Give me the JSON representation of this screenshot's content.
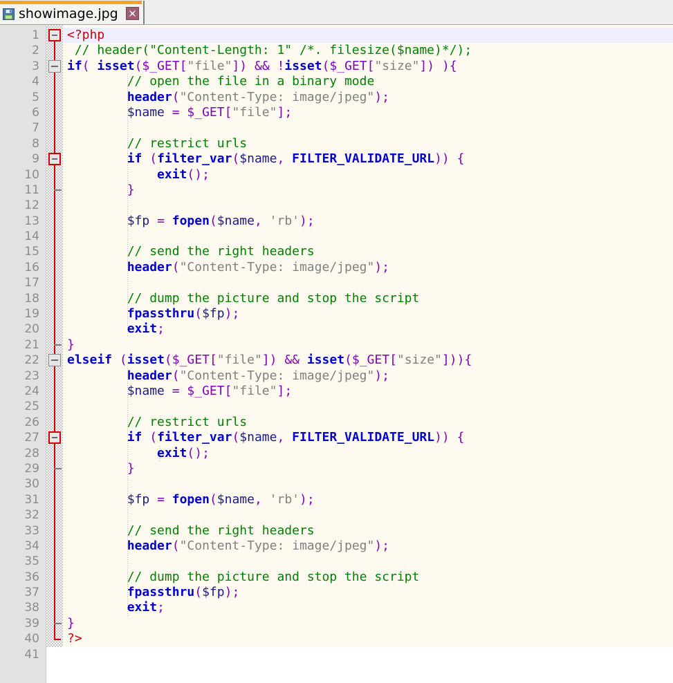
{
  "window": {
    "title": "showimage.jpg"
  },
  "tab": {
    "label": "showimage.jpg",
    "icon": "save-floppy-icon",
    "close_label": "×",
    "active_accent_color": "#f5a02b",
    "close_button_color": "#9d5f72"
  },
  "editor": {
    "language": "php",
    "first_line": 1,
    "last_line": 41,
    "current_line": 1,
    "background_color": "#fffaf0",
    "gutter_color": "#e2e2e2",
    "current_line_color": "#eeeeff",
    "fold_marker_color": "#d40000",
    "line_numbers": [
      "1",
      "2",
      "3",
      "4",
      "5",
      "6",
      "7",
      "8",
      "9",
      "10",
      "11",
      "12",
      "13",
      "14",
      "15",
      "16",
      "17",
      "18",
      "19",
      "20",
      "21",
      "22",
      "23",
      "24",
      "25",
      "26",
      "27",
      "28",
      "29",
      "30",
      "31",
      "32",
      "33",
      "34",
      "35",
      "36",
      "37",
      "38",
      "39",
      "40",
      "41"
    ],
    "lines": [
      {
        "n": 1,
        "tokens": [
          {
            "t": "<?php",
            "c": "t-php"
          }
        ]
      },
      {
        "n": 2,
        "tokens": [
          {
            "t": " ",
            "c": "t-plain"
          },
          {
            "t": "// header(\"Content-Length: 1\" /*. filesize($name)*/);",
            "c": "t-cmt"
          }
        ]
      },
      {
        "n": 3,
        "tokens": [
          {
            "t": "if",
            "c": "t-kw"
          },
          {
            "t": "(",
            "c": "t-op"
          },
          {
            "t": " ",
            "c": "t-plain"
          },
          {
            "t": "isset",
            "c": "t-fn"
          },
          {
            "t": "(",
            "c": "t-op"
          },
          {
            "t": "$_GET",
            "c": "t-op"
          },
          {
            "t": "[",
            "c": "t-op"
          },
          {
            "t": "\"file\"",
            "c": "t-str"
          },
          {
            "t": "])",
            "c": "t-op"
          },
          {
            "t": " ",
            "c": "t-plain"
          },
          {
            "t": "&&",
            "c": "t-op"
          },
          {
            "t": " ",
            "c": "t-plain"
          },
          {
            "t": "!",
            "c": "t-op"
          },
          {
            "t": "isset",
            "c": "t-fn"
          },
          {
            "t": "(",
            "c": "t-op"
          },
          {
            "t": "$_GET",
            "c": "t-op"
          },
          {
            "t": "[",
            "c": "t-op"
          },
          {
            "t": "\"size\"",
            "c": "t-str"
          },
          {
            "t": "])",
            "c": "t-op"
          },
          {
            "t": " ",
            "c": "t-plain"
          },
          {
            "t": "){",
            "c": "t-op"
          }
        ]
      },
      {
        "n": 4,
        "tokens": [
          {
            "t": "        ",
            "c": "t-plain"
          },
          {
            "t": "// open the file in a binary mode",
            "c": "t-cmt"
          }
        ]
      },
      {
        "n": 5,
        "tokens": [
          {
            "t": "        ",
            "c": "t-plain"
          },
          {
            "t": "header",
            "c": "t-fn"
          },
          {
            "t": "(",
            "c": "t-op"
          },
          {
            "t": "\"Content-Type: image/jpeg\"",
            "c": "t-str"
          },
          {
            "t": ");",
            "c": "t-op"
          }
        ]
      },
      {
        "n": 6,
        "tokens": [
          {
            "t": "        ",
            "c": "t-plain"
          },
          {
            "t": "$name",
            "c": "t-var"
          },
          {
            "t": " ",
            "c": "t-plain"
          },
          {
            "t": "=",
            "c": "t-op"
          },
          {
            "t": " ",
            "c": "t-plain"
          },
          {
            "t": "$_GET",
            "c": "t-op"
          },
          {
            "t": "[",
            "c": "t-op"
          },
          {
            "t": "\"file\"",
            "c": "t-str"
          },
          {
            "t": "];",
            "c": "t-op"
          }
        ]
      },
      {
        "n": 7,
        "tokens": []
      },
      {
        "n": 8,
        "tokens": [
          {
            "t": "        ",
            "c": "t-plain"
          },
          {
            "t": "// restrict urls",
            "c": "t-cmt"
          }
        ]
      },
      {
        "n": 9,
        "tokens": [
          {
            "t": "        ",
            "c": "t-plain"
          },
          {
            "t": "if",
            "c": "t-kw"
          },
          {
            "t": " ",
            "c": "t-plain"
          },
          {
            "t": "(",
            "c": "t-op"
          },
          {
            "t": "filter_var",
            "c": "t-fn"
          },
          {
            "t": "(",
            "c": "t-op"
          },
          {
            "t": "$name",
            "c": "t-var"
          },
          {
            "t": ",",
            "c": "t-op"
          },
          {
            "t": " ",
            "c": "t-plain"
          },
          {
            "t": "FILTER_VALIDATE_URL",
            "c": "t-const"
          },
          {
            "t": "))",
            "c": "t-op"
          },
          {
            "t": " ",
            "c": "t-plain"
          },
          {
            "t": "{",
            "c": "t-op"
          }
        ]
      },
      {
        "n": 10,
        "tokens": [
          {
            "t": "            ",
            "c": "t-plain"
          },
          {
            "t": "exit",
            "c": "t-kw"
          },
          {
            "t": "();",
            "c": "t-op"
          }
        ]
      },
      {
        "n": 11,
        "tokens": [
          {
            "t": "        ",
            "c": "t-plain"
          },
          {
            "t": "}",
            "c": "t-op"
          }
        ]
      },
      {
        "n": 12,
        "tokens": []
      },
      {
        "n": 13,
        "tokens": [
          {
            "t": "        ",
            "c": "t-plain"
          },
          {
            "t": "$fp",
            "c": "t-var"
          },
          {
            "t": " ",
            "c": "t-plain"
          },
          {
            "t": "=",
            "c": "t-op"
          },
          {
            "t": " ",
            "c": "t-plain"
          },
          {
            "t": "fopen",
            "c": "t-fn"
          },
          {
            "t": "(",
            "c": "t-op"
          },
          {
            "t": "$name",
            "c": "t-var"
          },
          {
            "t": ",",
            "c": "t-op"
          },
          {
            "t": " ",
            "c": "t-plain"
          },
          {
            "t": "'rb'",
            "c": "t-str"
          },
          {
            "t": ");",
            "c": "t-op"
          }
        ]
      },
      {
        "n": 14,
        "tokens": []
      },
      {
        "n": 15,
        "tokens": [
          {
            "t": "        ",
            "c": "t-plain"
          },
          {
            "t": "// send the right headers",
            "c": "t-cmt"
          }
        ]
      },
      {
        "n": 16,
        "tokens": [
          {
            "t": "        ",
            "c": "t-plain"
          },
          {
            "t": "header",
            "c": "t-fn"
          },
          {
            "t": "(",
            "c": "t-op"
          },
          {
            "t": "\"Content-Type: image/jpeg\"",
            "c": "t-str"
          },
          {
            "t": ");",
            "c": "t-op"
          }
        ]
      },
      {
        "n": 17,
        "tokens": []
      },
      {
        "n": 18,
        "tokens": [
          {
            "t": "        ",
            "c": "t-plain"
          },
          {
            "t": "// dump the picture and stop the script",
            "c": "t-cmt"
          }
        ]
      },
      {
        "n": 19,
        "tokens": [
          {
            "t": "        ",
            "c": "t-plain"
          },
          {
            "t": "fpassthru",
            "c": "t-fn"
          },
          {
            "t": "(",
            "c": "t-op"
          },
          {
            "t": "$fp",
            "c": "t-var"
          },
          {
            "t": ");",
            "c": "t-op"
          }
        ]
      },
      {
        "n": 20,
        "tokens": [
          {
            "t": "        ",
            "c": "t-plain"
          },
          {
            "t": "exit",
            "c": "t-kw"
          },
          {
            "t": ";",
            "c": "t-op"
          }
        ]
      },
      {
        "n": 21,
        "tokens": [
          {
            "t": "}",
            "c": "t-op"
          }
        ]
      },
      {
        "n": 22,
        "tokens": [
          {
            "t": "elseif",
            "c": "t-kw"
          },
          {
            "t": " ",
            "c": "t-plain"
          },
          {
            "t": "(",
            "c": "t-op"
          },
          {
            "t": "isset",
            "c": "t-fn"
          },
          {
            "t": "(",
            "c": "t-op"
          },
          {
            "t": "$_GET",
            "c": "t-op"
          },
          {
            "t": "[",
            "c": "t-op"
          },
          {
            "t": "\"file\"",
            "c": "t-str"
          },
          {
            "t": "])",
            "c": "t-op"
          },
          {
            "t": " ",
            "c": "t-plain"
          },
          {
            "t": "&&",
            "c": "t-op"
          },
          {
            "t": " ",
            "c": "t-plain"
          },
          {
            "t": "isset",
            "c": "t-fn"
          },
          {
            "t": "(",
            "c": "t-op"
          },
          {
            "t": "$_GET",
            "c": "t-op"
          },
          {
            "t": "[",
            "c": "t-op"
          },
          {
            "t": "\"size\"",
            "c": "t-str"
          },
          {
            "t": "])){",
            "c": "t-op"
          }
        ]
      },
      {
        "n": 23,
        "tokens": [
          {
            "t": "        ",
            "c": "t-plain"
          },
          {
            "t": "header",
            "c": "t-fn"
          },
          {
            "t": "(",
            "c": "t-op"
          },
          {
            "t": "\"Content-Type: image/jpeg\"",
            "c": "t-str"
          },
          {
            "t": ");",
            "c": "t-op"
          }
        ]
      },
      {
        "n": 24,
        "tokens": [
          {
            "t": "        ",
            "c": "t-plain"
          },
          {
            "t": "$name",
            "c": "t-var"
          },
          {
            "t": " ",
            "c": "t-plain"
          },
          {
            "t": "=",
            "c": "t-op"
          },
          {
            "t": " ",
            "c": "t-plain"
          },
          {
            "t": "$_GET",
            "c": "t-op"
          },
          {
            "t": "[",
            "c": "t-op"
          },
          {
            "t": "\"file\"",
            "c": "t-str"
          },
          {
            "t": "];",
            "c": "t-op"
          }
        ]
      },
      {
        "n": 25,
        "tokens": []
      },
      {
        "n": 26,
        "tokens": [
          {
            "t": "        ",
            "c": "t-plain"
          },
          {
            "t": "// restrict urls",
            "c": "t-cmt"
          }
        ]
      },
      {
        "n": 27,
        "tokens": [
          {
            "t": "        ",
            "c": "t-plain"
          },
          {
            "t": "if",
            "c": "t-kw"
          },
          {
            "t": " ",
            "c": "t-plain"
          },
          {
            "t": "(",
            "c": "t-op"
          },
          {
            "t": "filter_var",
            "c": "t-fn"
          },
          {
            "t": "(",
            "c": "t-op"
          },
          {
            "t": "$name",
            "c": "t-var"
          },
          {
            "t": ",",
            "c": "t-op"
          },
          {
            "t": " ",
            "c": "t-plain"
          },
          {
            "t": "FILTER_VALIDATE_URL",
            "c": "t-const"
          },
          {
            "t": "))",
            "c": "t-op"
          },
          {
            "t": " ",
            "c": "t-plain"
          },
          {
            "t": "{",
            "c": "t-op"
          }
        ]
      },
      {
        "n": 28,
        "tokens": [
          {
            "t": "            ",
            "c": "t-plain"
          },
          {
            "t": "exit",
            "c": "t-kw"
          },
          {
            "t": "();",
            "c": "t-op"
          }
        ]
      },
      {
        "n": 29,
        "tokens": [
          {
            "t": "        ",
            "c": "t-plain"
          },
          {
            "t": "}",
            "c": "t-op"
          }
        ]
      },
      {
        "n": 30,
        "tokens": []
      },
      {
        "n": 31,
        "tokens": [
          {
            "t": "        ",
            "c": "t-plain"
          },
          {
            "t": "$fp",
            "c": "t-var"
          },
          {
            "t": " ",
            "c": "t-plain"
          },
          {
            "t": "=",
            "c": "t-op"
          },
          {
            "t": " ",
            "c": "t-plain"
          },
          {
            "t": "fopen",
            "c": "t-fn"
          },
          {
            "t": "(",
            "c": "t-op"
          },
          {
            "t": "$name",
            "c": "t-var"
          },
          {
            "t": ",",
            "c": "t-op"
          },
          {
            "t": " ",
            "c": "t-plain"
          },
          {
            "t": "'rb'",
            "c": "t-str"
          },
          {
            "t": ");",
            "c": "t-op"
          }
        ]
      },
      {
        "n": 32,
        "tokens": []
      },
      {
        "n": 33,
        "tokens": [
          {
            "t": "        ",
            "c": "t-plain"
          },
          {
            "t": "// send the right headers",
            "c": "t-cmt"
          }
        ]
      },
      {
        "n": 34,
        "tokens": [
          {
            "t": "        ",
            "c": "t-plain"
          },
          {
            "t": "header",
            "c": "t-fn"
          },
          {
            "t": "(",
            "c": "t-op"
          },
          {
            "t": "\"Content-Type: image/jpeg\"",
            "c": "t-str"
          },
          {
            "t": ");",
            "c": "t-op"
          }
        ]
      },
      {
        "n": 35,
        "tokens": []
      },
      {
        "n": 36,
        "tokens": [
          {
            "t": "        ",
            "c": "t-plain"
          },
          {
            "t": "// dump the picture and stop the script",
            "c": "t-cmt"
          }
        ]
      },
      {
        "n": 37,
        "tokens": [
          {
            "t": "        ",
            "c": "t-plain"
          },
          {
            "t": "fpassthru",
            "c": "t-fn"
          },
          {
            "t": "(",
            "c": "t-op"
          },
          {
            "t": "$fp",
            "c": "t-var"
          },
          {
            "t": ");",
            "c": "t-op"
          }
        ]
      },
      {
        "n": 38,
        "tokens": [
          {
            "t": "        ",
            "c": "t-plain"
          },
          {
            "t": "exit",
            "c": "t-kw"
          },
          {
            "t": ";",
            "c": "t-op"
          }
        ]
      },
      {
        "n": 39,
        "tokens": [
          {
            "t": "}",
            "c": "t-op"
          }
        ]
      },
      {
        "n": 40,
        "tokens": [
          {
            "t": "?>",
            "c": "t-php"
          }
        ]
      },
      {
        "n": 41,
        "tokens": []
      }
    ],
    "fold_markers": [
      {
        "line": 1,
        "type": "open-box",
        "color": "red"
      },
      {
        "line": 3,
        "type": "open-box",
        "color": "gray"
      },
      {
        "line": 9,
        "type": "open-box",
        "color": "red"
      },
      {
        "line": 11,
        "type": "end-tick",
        "color": "gray"
      },
      {
        "line": 21,
        "type": "end-tick",
        "color": "gray"
      },
      {
        "line": 22,
        "type": "open-box",
        "color": "gray"
      },
      {
        "line": 27,
        "type": "open-box",
        "color": "red"
      },
      {
        "line": 29,
        "type": "end-tick",
        "color": "gray"
      },
      {
        "line": 39,
        "type": "end-tick",
        "color": "gray"
      },
      {
        "line": 40,
        "type": "end-corner",
        "color": "red"
      }
    ]
  }
}
